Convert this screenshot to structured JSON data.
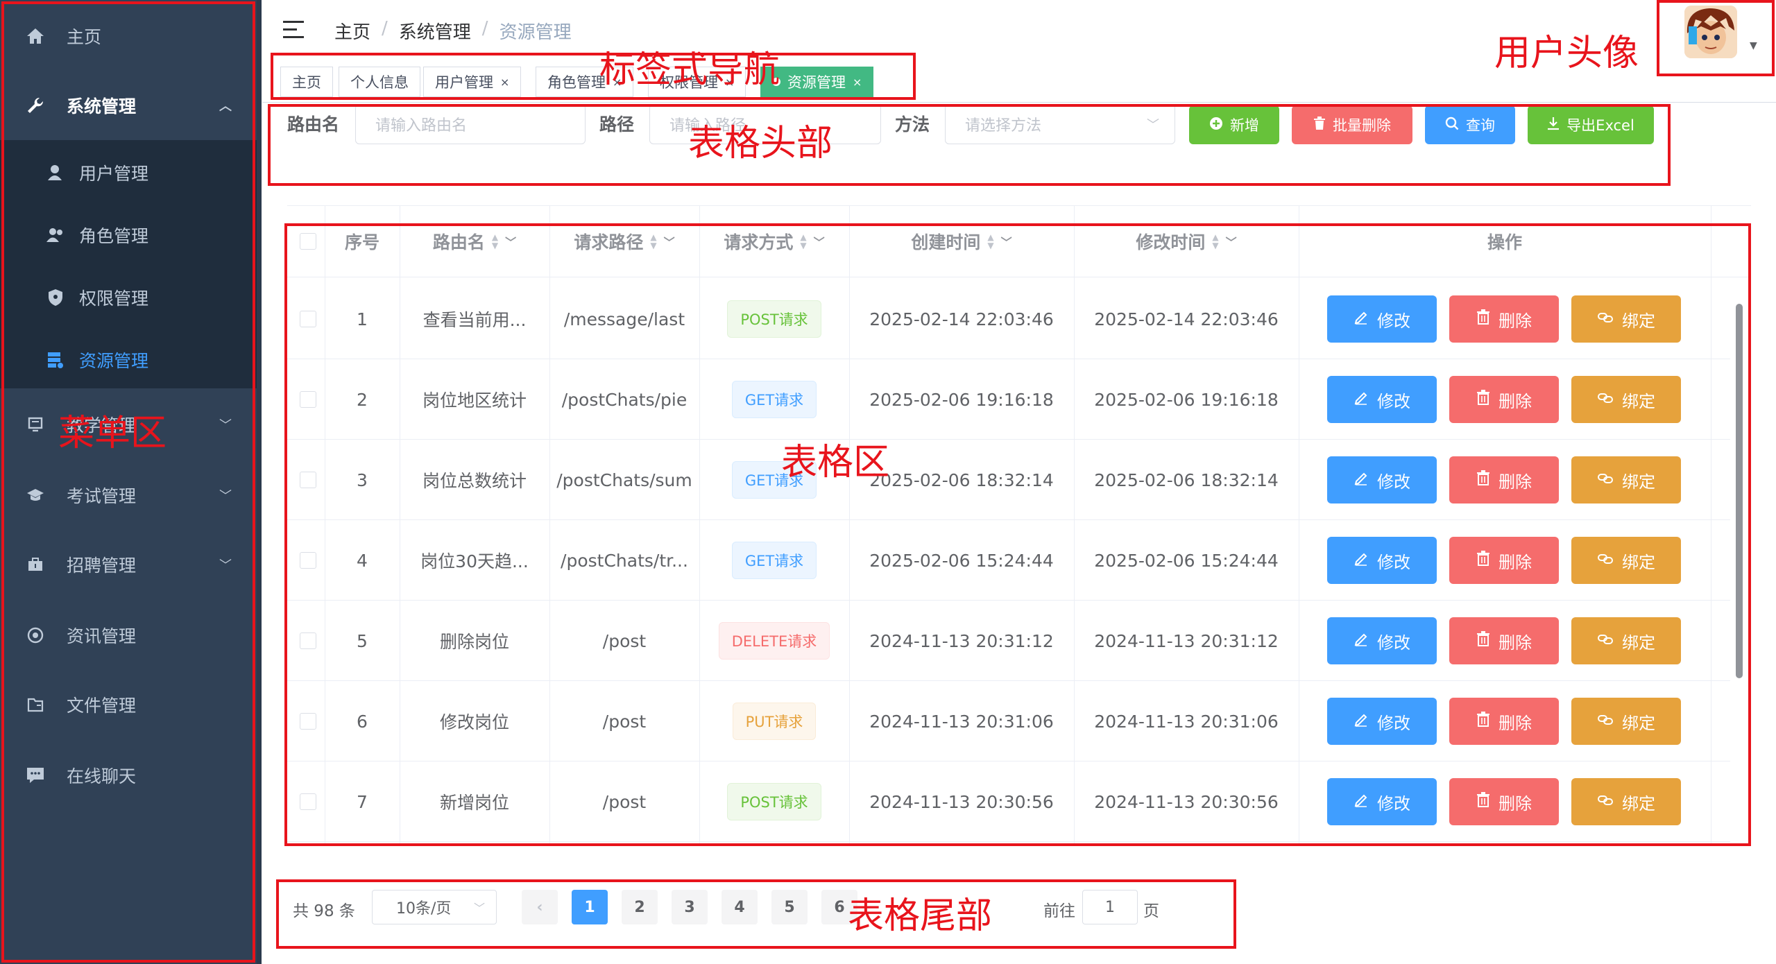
{
  "sidebar": {
    "home": "主页",
    "system": "系统管理",
    "sub_items": [
      "用户管理",
      "角色管理",
      "权限管理",
      "资源管理"
    ],
    "teaching": "教学管理",
    "exam": "考试管理",
    "recruit": "招聘管理",
    "news": "资讯管理",
    "files": "文件管理",
    "chat": "在线聊天"
  },
  "header": {
    "breadcrumb": [
      "主页",
      "系统管理",
      "资源管理"
    ],
    "breadcrumb_sep": "/"
  },
  "tags": [
    "主页",
    "个人信息",
    "用户管理",
    "角色管理",
    "权限管理",
    "资源管理"
  ],
  "filters": {
    "route_label": "路由名",
    "route_placeholder": "请输入路由名",
    "path_label": "路径",
    "path_placeholder": "请输入路径",
    "method_label": "方法",
    "method_placeholder": "请选择方法"
  },
  "buttons": {
    "add": "新增",
    "batch_delete": "批量删除",
    "query": "查询",
    "export": "导出Excel"
  },
  "table": {
    "headers": [
      "序号",
      "路由名",
      "请求路径",
      "请求方式",
      "创建时间",
      "修改时间",
      "操作"
    ],
    "rows": [
      {
        "no": "1",
        "name": "查看当前用...",
        "path": "/message/last",
        "method": "POST请求",
        "created": "2025-02-14 22:03:46",
        "updated": "2025-02-14 22:03:46"
      },
      {
        "no": "2",
        "name": "岗位地区统计",
        "path": "/postChats/pie",
        "method": "GET请求",
        "created": "2025-02-06 19:16:18",
        "updated": "2025-02-06 19:16:18"
      },
      {
        "no": "3",
        "name": "岗位总数统计",
        "path": "/postChats/sum",
        "method": "GET请求",
        "created": "2025-02-06 18:32:14",
        "updated": "2025-02-06 18:32:14"
      },
      {
        "no": "4",
        "name": "岗位30天趋...",
        "path": "/postChats/tr...",
        "method": "GET请求",
        "created": "2025-02-06 15:24:44",
        "updated": "2025-02-06 15:24:44"
      },
      {
        "no": "5",
        "name": "删除岗位",
        "path": "/post",
        "method": "DELETE请求",
        "created": "2024-11-13 20:31:12",
        "updated": "2024-11-13 20:31:12"
      },
      {
        "no": "6",
        "name": "修改岗位",
        "path": "/post",
        "method": "PUT请求",
        "created": "2024-11-13 20:31:06",
        "updated": "2024-11-13 20:31:06"
      },
      {
        "no": "7",
        "name": "新增岗位",
        "path": "/post",
        "method": "POST请求",
        "created": "2024-11-13 20:30:56",
        "updated": "2024-11-13 20:30:56"
      }
    ],
    "actions": {
      "edit": "修改",
      "delete": "删除",
      "bind": "绑定"
    }
  },
  "pagination": {
    "total": "共 98 条",
    "page_size": "10条/页",
    "pages": [
      "1",
      "2",
      "3",
      "4",
      "5",
      "6"
    ],
    "current": "1",
    "goto_label": "前往",
    "goto_value": "1",
    "page_suffix": "页"
  },
  "annotations": {
    "tabs": "标签式导航",
    "avatar": "用户头像",
    "table_header": "表格头部",
    "menu": "菜单区",
    "table": "表格区",
    "table_footer": "表格尾部"
  },
  "colors": {
    "sidebar_bg": "#304156",
    "primary": "#409eff",
    "success": "#67c23a",
    "danger": "#f56c6c",
    "warning": "#e6a23c",
    "active_tag": "#42b983",
    "annotation": "#e8141c"
  }
}
